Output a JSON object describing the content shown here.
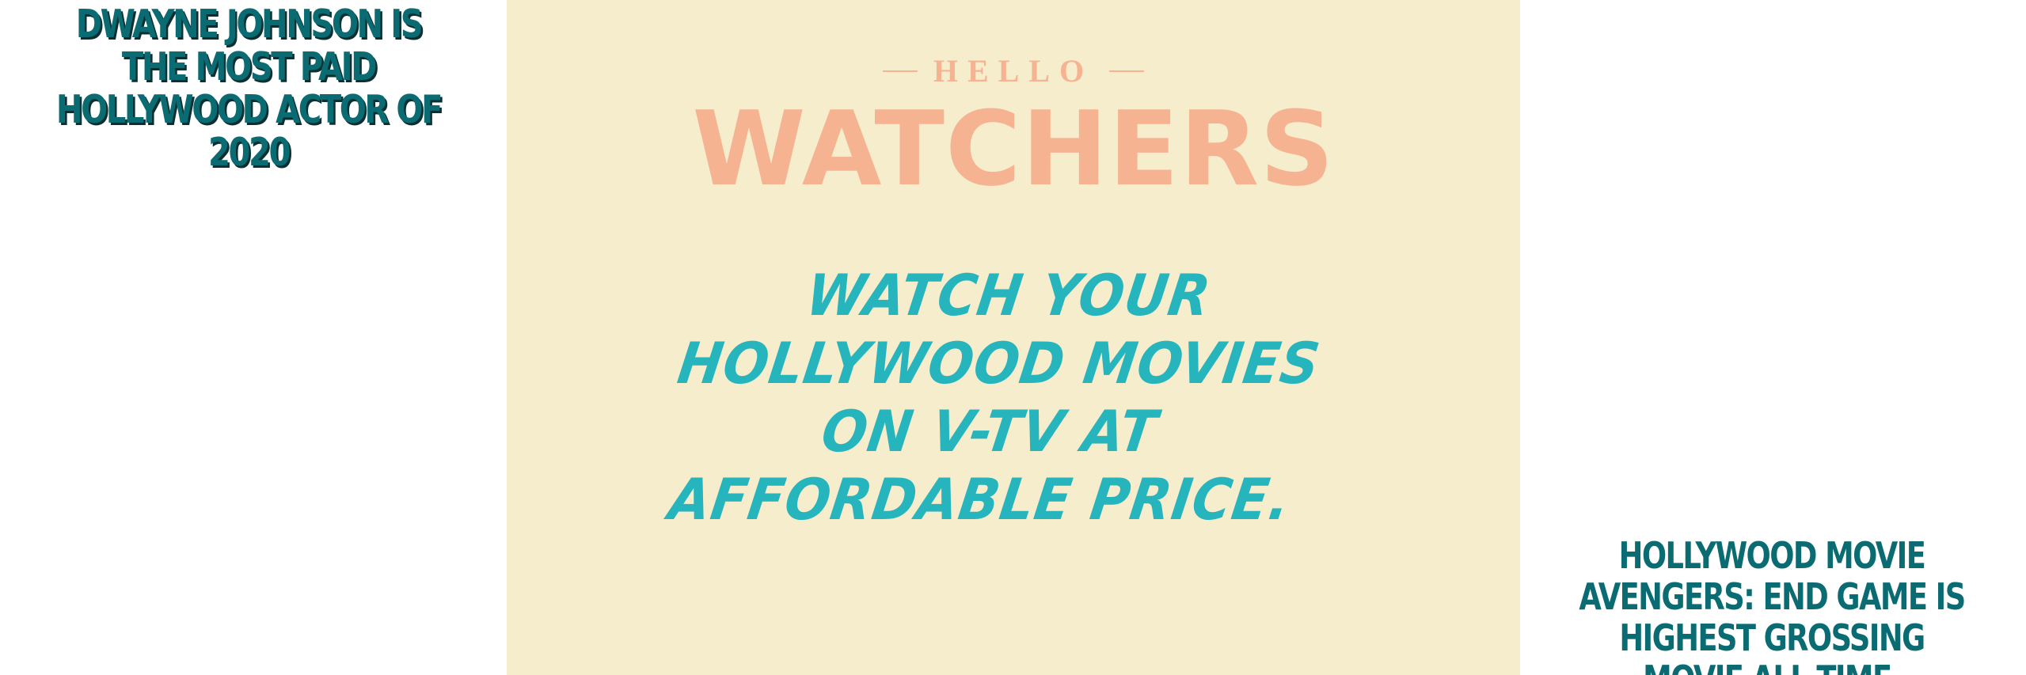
{
  "left_headline": "DWAYNE JOHNSON IS THE MOST PAID HOLLYWOOD ACTOR OF 2020",
  "banner": {
    "hello": "HELLO",
    "title": "WATCHERS",
    "tagline": "WATCH YOUR HOLLYWOOD MOVIES ON V-TV AT AFFORDABLE PRICE.",
    "background_color": "#f6edcd",
    "title_color": "#f6b392",
    "tagline_color": "#26b4bd"
  },
  "right_headline": "HOLLYWOOD MOVIE AVENGERS: END GAME IS HIGHEST GROSSING MOVIE ALL TIME.",
  "headline_color": "#0a6c72"
}
